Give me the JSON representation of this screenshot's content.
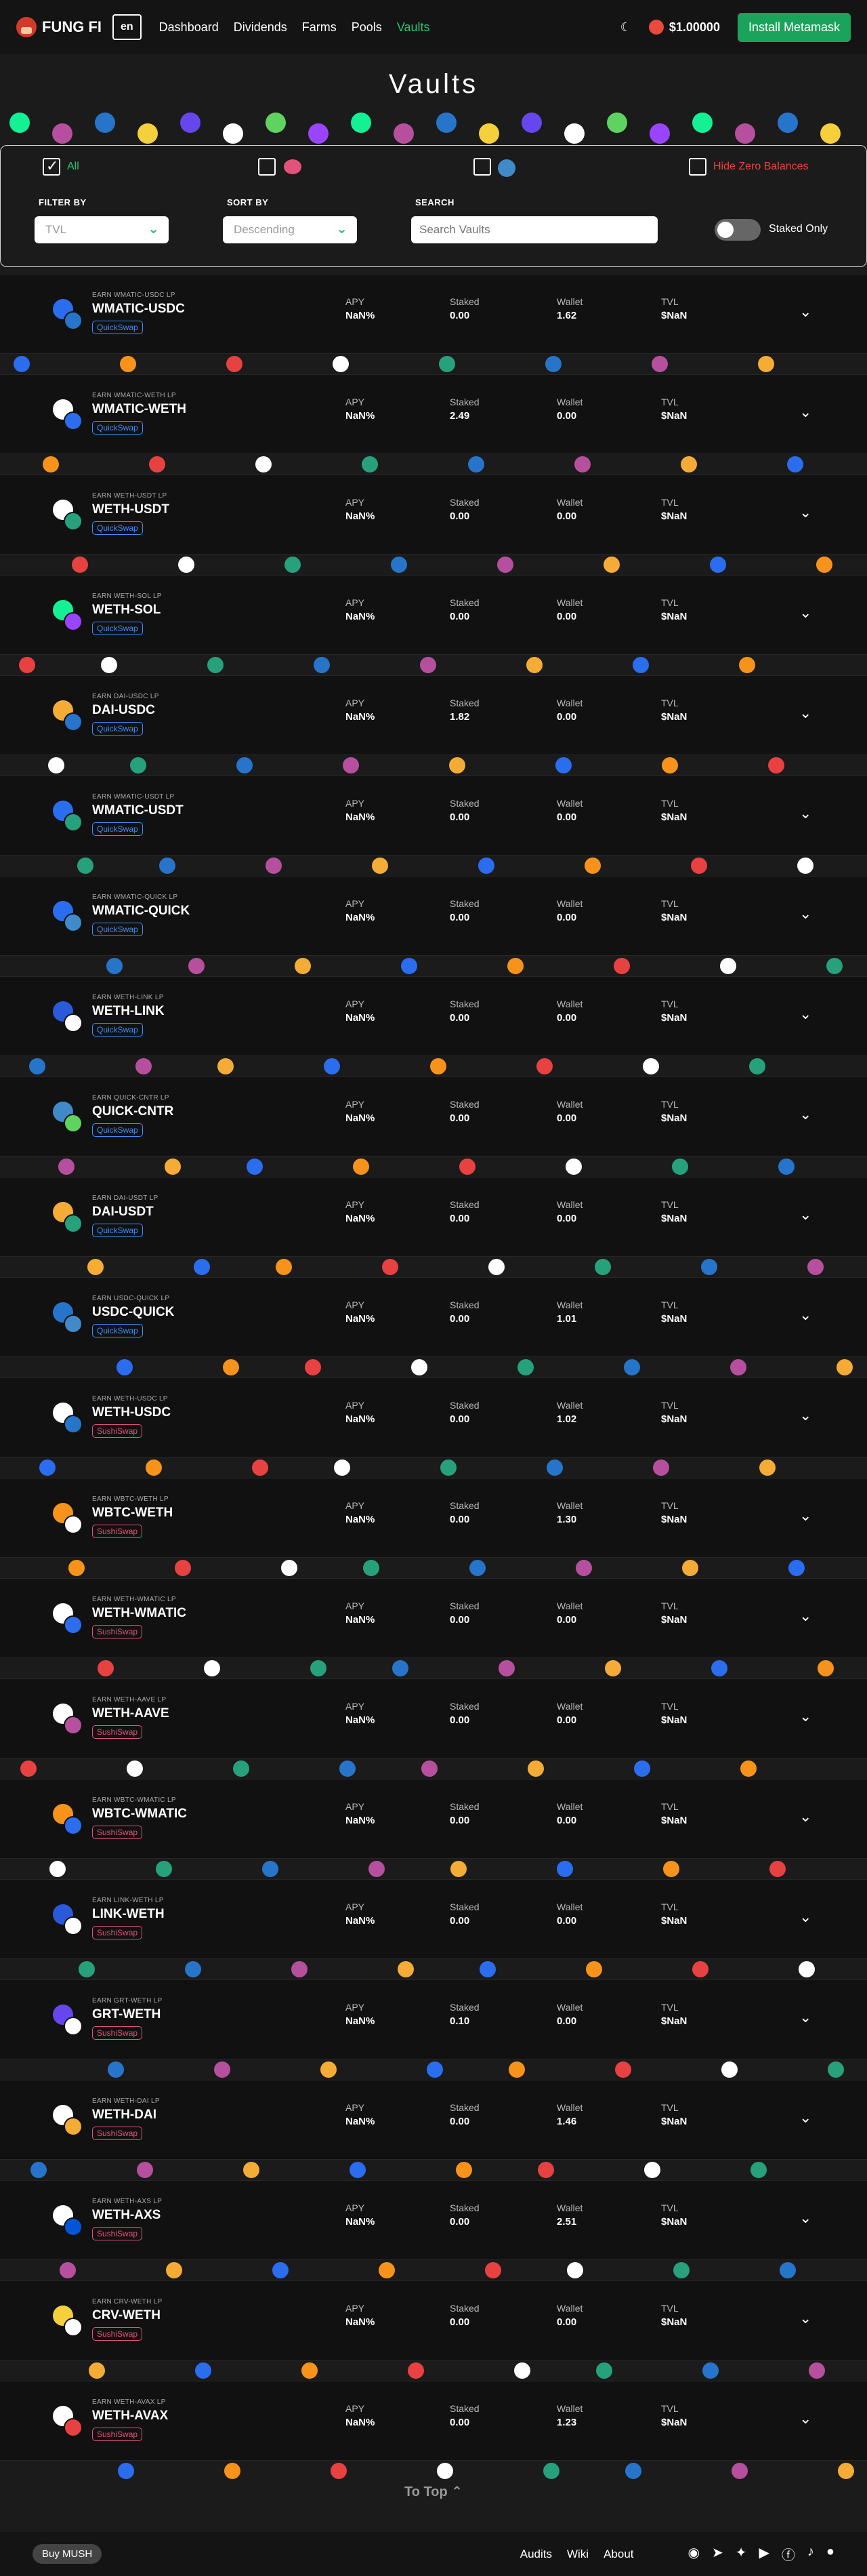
{
  "nav": {
    "brand": "FUNG FI",
    "lang": "en",
    "links": [
      "Dashboard",
      "Dividends",
      "Farms",
      "Pools",
      "Vaults"
    ],
    "active": "Vaults",
    "theme_icon": "moon-icon",
    "price": "$1.00000",
    "install": "Install Metamask"
  },
  "page": {
    "title": "Vaults"
  },
  "filters": {
    "all_label": "All",
    "hide_zero": "Hide Zero Balances",
    "filter_by": "FILTER BY",
    "filter_value": "TVL",
    "sort_by": "SORT BY",
    "sort_value": "Descending",
    "search_label": "SEARCH",
    "search_placeholder": "Search Vaults",
    "staked_only": "Staked Only"
  },
  "labels": {
    "apy": "APY",
    "staked": "Staked",
    "wallet": "Wallet",
    "tvl": "TVL"
  },
  "vaults": [
    {
      "earn": "EARN WMATIC-USDC LP",
      "name": "WMATIC-USDC",
      "platform": "QuickSwap",
      "apy": "NaN%",
      "staked": "0.00",
      "wallet": "1.62",
      "tvl": "$NaN",
      "c1": "#2b6def",
      "c2": "#2775ca"
    },
    {
      "earn": "EARN WMATIC-WETH LP",
      "name": "WMATIC-WETH",
      "platform": "QuickSwap",
      "apy": "NaN%",
      "staked": "2.49",
      "wallet": "0.00",
      "tvl": "$NaN",
      "c1": "#ffffff",
      "c2": "#2b6def"
    },
    {
      "earn": "EARN WETH-USDT LP",
      "name": "WETH-USDT",
      "platform": "QuickSwap",
      "apy": "NaN%",
      "staked": "0.00",
      "wallet": "0.00",
      "tvl": "$NaN",
      "c1": "#ffffff",
      "c2": "#26a17b"
    },
    {
      "earn": "EARN WETH-SOL LP",
      "name": "WETH-SOL",
      "platform": "QuickSwap",
      "apy": "NaN%",
      "staked": "0.00",
      "wallet": "0.00",
      "tvl": "$NaN",
      "c1": "#14f195",
      "c2": "#9945ff"
    },
    {
      "earn": "EARN DAI-USDC LP",
      "name": "DAI-USDC",
      "platform": "QuickSwap",
      "apy": "NaN%",
      "staked": "1.82",
      "wallet": "0.00",
      "tvl": "$NaN",
      "c1": "#f5ac37",
      "c2": "#2775ca"
    },
    {
      "earn": "EARN WMATIC-USDT LP",
      "name": "WMATIC-USDT",
      "platform": "QuickSwap",
      "apy": "NaN%",
      "staked": "0.00",
      "wallet": "0.00",
      "tvl": "$NaN",
      "c1": "#2b6def",
      "c2": "#26a17b"
    },
    {
      "earn": "EARN WMATIC-QUICK LP",
      "name": "WMATIC-QUICK",
      "platform": "QuickSwap",
      "apy": "NaN%",
      "staked": "0.00",
      "wallet": "0.00",
      "tvl": "$NaN",
      "c1": "#2b6def",
      "c2": "#418aca"
    },
    {
      "earn": "EARN WETH-LINK LP",
      "name": "WETH-LINK",
      "platform": "QuickSwap",
      "apy": "NaN%",
      "staked": "0.00",
      "wallet": "0.00",
      "tvl": "$NaN",
      "c1": "#2a5ada",
      "c2": "#ffffff"
    },
    {
      "earn": "EARN QUICK-CNTR LP",
      "name": "QUICK-CNTR",
      "platform": "QuickSwap",
      "apy": "NaN%",
      "staked": "0.00",
      "wallet": "0.00",
      "tvl": "$NaN",
      "c1": "#418aca",
      "c2": "#5fd35f"
    },
    {
      "earn": "EARN DAI-USDT LP",
      "name": "DAI-USDT",
      "platform": "QuickSwap",
      "apy": "NaN%",
      "staked": "0.00",
      "wallet": "0.00",
      "tvl": "$NaN",
      "c1": "#f5ac37",
      "c2": "#26a17b"
    },
    {
      "earn": "EARN USDC-QUICK LP",
      "name": "USDC-QUICK",
      "platform": "QuickSwap",
      "apy": "NaN%",
      "staked": "0.00",
      "wallet": "1.01",
      "tvl": "$NaN",
      "c1": "#2775ca",
      "c2": "#418aca"
    },
    {
      "earn": "EARN WETH-USDC LP",
      "name": "WETH-USDC",
      "platform": "SushiSwap",
      "apy": "NaN%",
      "staked": "0.00",
      "wallet": "1.02",
      "tvl": "$NaN",
      "c1": "#ffffff",
      "c2": "#2775ca"
    },
    {
      "earn": "EARN WBTC-WETH LP",
      "name": "WBTC-WETH",
      "platform": "SushiSwap",
      "apy": "NaN%",
      "staked": "0.00",
      "wallet": "1.30",
      "tvl": "$NaN",
      "c1": "#f7931a",
      "c2": "#ffffff"
    },
    {
      "earn": "EARN WETH-WMATIC LP",
      "name": "WETH-WMATIC",
      "platform": "SushiSwap",
      "apy": "NaN%",
      "staked": "0.00",
      "wallet": "0.00",
      "tvl": "$NaN",
      "c1": "#ffffff",
      "c2": "#2b6def"
    },
    {
      "earn": "EARN WETH-AAVE LP",
      "name": "WETH-AAVE",
      "platform": "SushiSwap",
      "apy": "NaN%",
      "staked": "0.00",
      "wallet": "0.00",
      "tvl": "$NaN",
      "c1": "#ffffff",
      "c2": "#b6509e"
    },
    {
      "earn": "EARN WBTC-WMATIC LP",
      "name": "WBTC-WMATIC",
      "platform": "SushiSwap",
      "apy": "NaN%",
      "staked": "0.00",
      "wallet": "0.00",
      "tvl": "$NaN",
      "c1": "#f7931a",
      "c2": "#2b6def"
    },
    {
      "earn": "EARN LINK-WETH LP",
      "name": "LINK-WETH",
      "platform": "SushiSwap",
      "apy": "NaN%",
      "staked": "0.00",
      "wallet": "0.00",
      "tvl": "$NaN",
      "c1": "#2a5ada",
      "c2": "#ffffff"
    },
    {
      "earn": "EARN GRT-WETH LP",
      "name": "GRT-WETH",
      "platform": "SushiSwap",
      "apy": "NaN%",
      "staked": "0.10",
      "wallet": "0.00",
      "tvl": "$NaN",
      "c1": "#6747ed",
      "c2": "#ffffff"
    },
    {
      "earn": "EARN WETH-DAI LP",
      "name": "WETH-DAI",
      "platform": "SushiSwap",
      "apy": "NaN%",
      "staked": "0.00",
      "wallet": "1.46",
      "tvl": "$NaN",
      "c1": "#ffffff",
      "c2": "#f5ac37"
    },
    {
      "earn": "EARN WETH-AXS LP",
      "name": "WETH-AXS",
      "platform": "SushiSwap",
      "apy": "NaN%",
      "staked": "0.00",
      "wallet": "2.51",
      "tvl": "$NaN",
      "c1": "#ffffff",
      "c2": "#0055d5"
    },
    {
      "earn": "EARN CRV-WETH LP",
      "name": "CRV-WETH",
      "platform": "SushiSwap",
      "apy": "NaN%",
      "staked": "0.00",
      "wallet": "0.00",
      "tvl": "$NaN",
      "c1": "#f5d03c",
      "c2": "#ffffff"
    },
    {
      "earn": "EARN WETH-AVAX LP",
      "name": "WETH-AVAX",
      "platform": "SushiSwap",
      "apy": "NaN%",
      "staked": "0.00",
      "wallet": "1.23",
      "tvl": "$NaN",
      "c1": "#ffffff",
      "c2": "#e84142"
    }
  ],
  "to_top": "To Top ⌃",
  "footer": {
    "buy": "Buy MUSH",
    "links": [
      "Audits",
      "Wiki",
      "About"
    ],
    "socials": [
      "discord-icon",
      "telegram-icon",
      "twitter-icon",
      "youtube-icon",
      "facebook-icon",
      "tiktok-icon",
      "github-icon"
    ]
  },
  "colors": {
    "accent": "#28c76f",
    "quickswap": "#3f8cff",
    "sushiswap": "#e2537c",
    "hide_zero": "#e8453c"
  }
}
